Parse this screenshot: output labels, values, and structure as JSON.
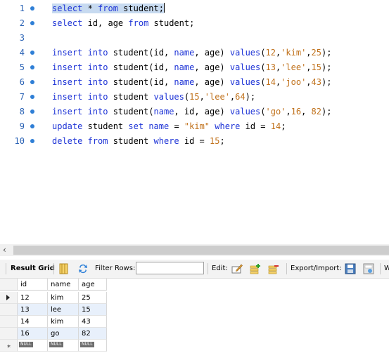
{
  "editor": {
    "lines": [
      {
        "num": "1",
        "tokens": [
          {
            "t": "select",
            "c": "kw"
          },
          {
            "t": " * "
          },
          {
            "t": "from",
            "c": "kw"
          },
          {
            "t": " student;"
          }
        ]
      },
      {
        "num": "2",
        "tokens": [
          {
            "t": "select",
            "c": "kw"
          },
          {
            "t": " id, age "
          },
          {
            "t": "from",
            "c": "kw"
          },
          {
            "t": " student;"
          }
        ]
      },
      {
        "num": "3",
        "tokens": []
      },
      {
        "num": "4",
        "tokens": [
          {
            "t": "insert into",
            "c": "kw"
          },
          {
            "t": " student(id, "
          },
          {
            "t": "name",
            "c": "kw"
          },
          {
            "t": ", age) "
          },
          {
            "t": "values",
            "c": "kw"
          },
          {
            "t": "("
          },
          {
            "t": "12",
            "c": "num"
          },
          {
            "t": ","
          },
          {
            "t": "'kim'",
            "c": "str"
          },
          {
            "t": ","
          },
          {
            "t": "25",
            "c": "num"
          },
          {
            "t": ");"
          }
        ]
      },
      {
        "num": "5",
        "tokens": [
          {
            "t": "insert into",
            "c": "kw"
          },
          {
            "t": " student(id, "
          },
          {
            "t": "name",
            "c": "kw"
          },
          {
            "t": ", age) "
          },
          {
            "t": "values",
            "c": "kw"
          },
          {
            "t": "("
          },
          {
            "t": "13",
            "c": "num"
          },
          {
            "t": ","
          },
          {
            "t": "'lee'",
            "c": "str"
          },
          {
            "t": ","
          },
          {
            "t": "15",
            "c": "num"
          },
          {
            "t": ");"
          }
        ]
      },
      {
        "num": "6",
        "tokens": [
          {
            "t": "insert into",
            "c": "kw"
          },
          {
            "t": " student(id, "
          },
          {
            "t": "name",
            "c": "kw"
          },
          {
            "t": ", age) "
          },
          {
            "t": "values",
            "c": "kw"
          },
          {
            "t": "("
          },
          {
            "t": "14",
            "c": "num"
          },
          {
            "t": ","
          },
          {
            "t": "'joo'",
            "c": "str"
          },
          {
            "t": ","
          },
          {
            "t": "43",
            "c": "num"
          },
          {
            "t": ");"
          }
        ]
      },
      {
        "num": "7",
        "tokens": [
          {
            "t": "insert into",
            "c": "kw"
          },
          {
            "t": " student "
          },
          {
            "t": "values",
            "c": "kw"
          },
          {
            "t": "("
          },
          {
            "t": "15",
            "c": "num"
          },
          {
            "t": ","
          },
          {
            "t": "'lee'",
            "c": "str"
          },
          {
            "t": ","
          },
          {
            "t": "64",
            "c": "num"
          },
          {
            "t": ");"
          }
        ]
      },
      {
        "num": "8",
        "tokens": [
          {
            "t": "insert into",
            "c": "kw"
          },
          {
            "t": " student("
          },
          {
            "t": "name",
            "c": "kw"
          },
          {
            "t": ", id, age) "
          },
          {
            "t": "values",
            "c": "kw"
          },
          {
            "t": "("
          },
          {
            "t": "'go'",
            "c": "str"
          },
          {
            "t": ","
          },
          {
            "t": "16",
            "c": "num"
          },
          {
            "t": ", "
          },
          {
            "t": "82",
            "c": "num"
          },
          {
            "t": ");"
          }
        ]
      },
      {
        "num": "9",
        "tokens": [
          {
            "t": "update",
            "c": "kw"
          },
          {
            "t": " student "
          },
          {
            "t": "set",
            "c": "kw"
          },
          {
            "t": " "
          },
          {
            "t": "name",
            "c": "kw"
          },
          {
            "t": " = "
          },
          {
            "t": "\"kim\"",
            "c": "str"
          },
          {
            "t": " "
          },
          {
            "t": "where",
            "c": "kw"
          },
          {
            "t": " id = "
          },
          {
            "t": "14",
            "c": "num"
          },
          {
            "t": ";"
          }
        ]
      },
      {
        "num": "10",
        "tokens": [
          {
            "t": "delete from",
            "c": "kw"
          },
          {
            "t": " student "
          },
          {
            "t": "where",
            "c": "kw"
          },
          {
            "t": " id = "
          },
          {
            "t": "15",
            "c": "num"
          },
          {
            "t": ";"
          }
        ]
      }
    ]
  },
  "toolbar": {
    "result_grid_label": "Result Grid",
    "filter_label": "Filter Rows:",
    "filter_value": "",
    "edit_label": "Edit:",
    "export_label": "Export/Import:",
    "truncated_label": "W"
  },
  "grid": {
    "columns": [
      "id",
      "name",
      "age"
    ],
    "rows": [
      [
        "12",
        "kim",
        "25"
      ],
      [
        "13",
        "lee",
        "15"
      ],
      [
        "14",
        "kim",
        "43"
      ],
      [
        "16",
        "go",
        "82"
      ]
    ],
    "new_row": [
      "NULL",
      "NULL",
      "NULL"
    ],
    "new_row_marker": "*"
  },
  "colors": {
    "keyword": "#1d33d6",
    "literal": "#c0711b",
    "line_number": "#2b63b5",
    "selection": "#c7daf0",
    "alt_row": "#e8f0fb"
  }
}
